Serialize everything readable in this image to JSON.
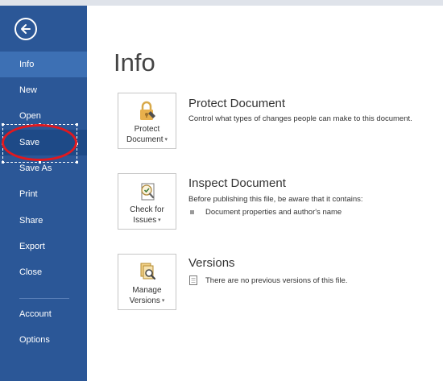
{
  "sidebar": {
    "items": [
      {
        "label": "Info"
      },
      {
        "label": "New"
      },
      {
        "label": "Open"
      },
      {
        "label": "Save"
      },
      {
        "label": "Save As"
      },
      {
        "label": "Print"
      },
      {
        "label": "Share"
      },
      {
        "label": "Export"
      },
      {
        "label": "Close"
      },
      {
        "label": "Account"
      },
      {
        "label": "Options"
      }
    ],
    "active": "Info",
    "highlighted": "Save"
  },
  "main": {
    "title": "Info",
    "sections": [
      {
        "button_line1": "Protect",
        "button_line2": "Document",
        "icon": "lock-key-icon",
        "heading": "Protect Document",
        "description": "Control what types of changes people can make to this document."
      },
      {
        "button_line1": "Check for",
        "button_line2": "Issues",
        "icon": "inspect-document-icon",
        "heading": "Inspect Document",
        "description": "Before publishing this file, be aware that it contains:",
        "bullets": [
          "Document properties and author's name"
        ]
      },
      {
        "button_line1": "Manage",
        "button_line2": "Versions",
        "icon": "manage-versions-icon",
        "heading": "Versions",
        "description": "There are no previous versions of this file."
      }
    ]
  },
  "colors": {
    "sidebar": "#2b5797",
    "sidebar_active": "#3d70b4",
    "annotation": "#e0191f"
  }
}
